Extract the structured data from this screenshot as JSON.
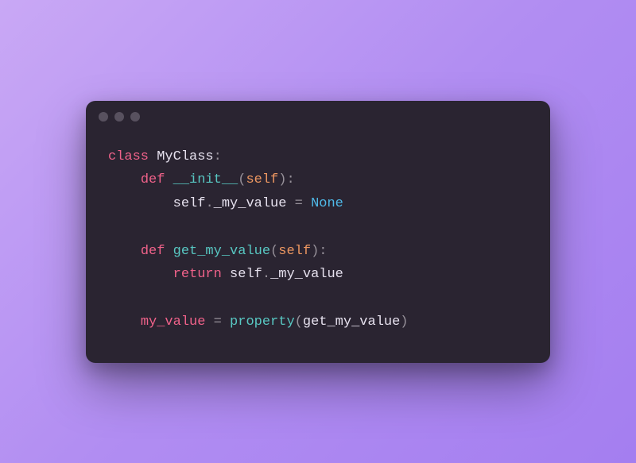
{
  "code": {
    "tokens": {
      "class_kw": "class",
      "class_name": "MyClass",
      "colon": ":",
      "def_kw": "def",
      "init_name": "__init__",
      "lparen": "(",
      "rparen": ")",
      "self_param": "self",
      "dot": ".",
      "my_value_priv": "_my_value",
      "eq": " = ",
      "none_lit": "None",
      "get_my_value_name": "get_my_value",
      "return_kw": "return",
      "my_value_name": "my_value",
      "property_name": "property"
    }
  }
}
